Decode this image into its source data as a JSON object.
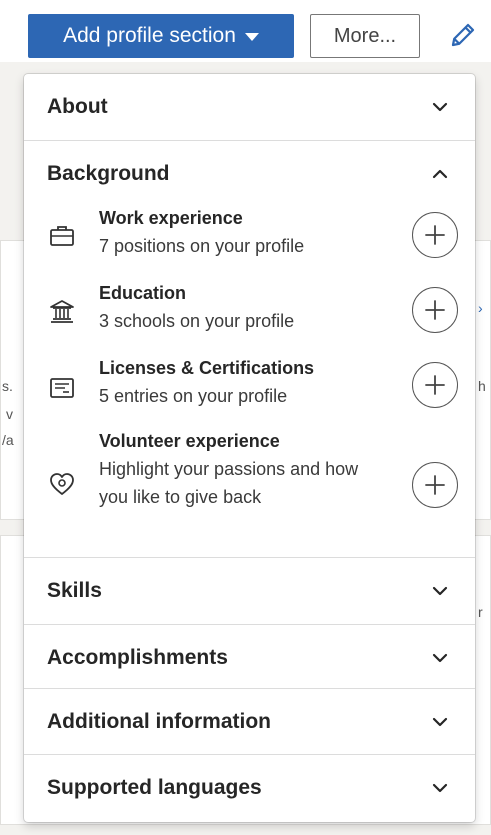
{
  "toolbar": {
    "add_section_label": "Add profile section",
    "more_label": "More...",
    "edit_icon": "pencil-icon"
  },
  "background_fragments": [
    "s.",
    "v",
    "/a",
    "r",
    "h"
  ],
  "dropdown": {
    "sections": [
      {
        "label": "About",
        "state": "collapsed"
      },
      {
        "label": "Background",
        "state": "expanded"
      },
      {
        "label": "Skills",
        "state": "collapsed"
      },
      {
        "label": "Accomplishments",
        "state": "collapsed"
      },
      {
        "label": "Additional information",
        "state": "collapsed"
      },
      {
        "label": "Supported languages",
        "state": "collapsed"
      }
    ],
    "background_items": [
      {
        "icon": "briefcase-icon",
        "title": "Work experience",
        "subtitle": "7 positions on your profile"
      },
      {
        "icon": "school-icon",
        "title": "Education",
        "subtitle": "3 schools on your profile"
      },
      {
        "icon": "certificate-icon",
        "title": "Licenses & Certifications",
        "subtitle": "5 entries on your profile"
      },
      {
        "icon": "heart-hand-icon",
        "title": "Volunteer experience",
        "subtitle": "Highlight your passions and how you like to give back"
      }
    ]
  },
  "colors": {
    "primary_button": "#2d67b4",
    "edit_icon": "#2d67b4",
    "text": "#262626"
  }
}
